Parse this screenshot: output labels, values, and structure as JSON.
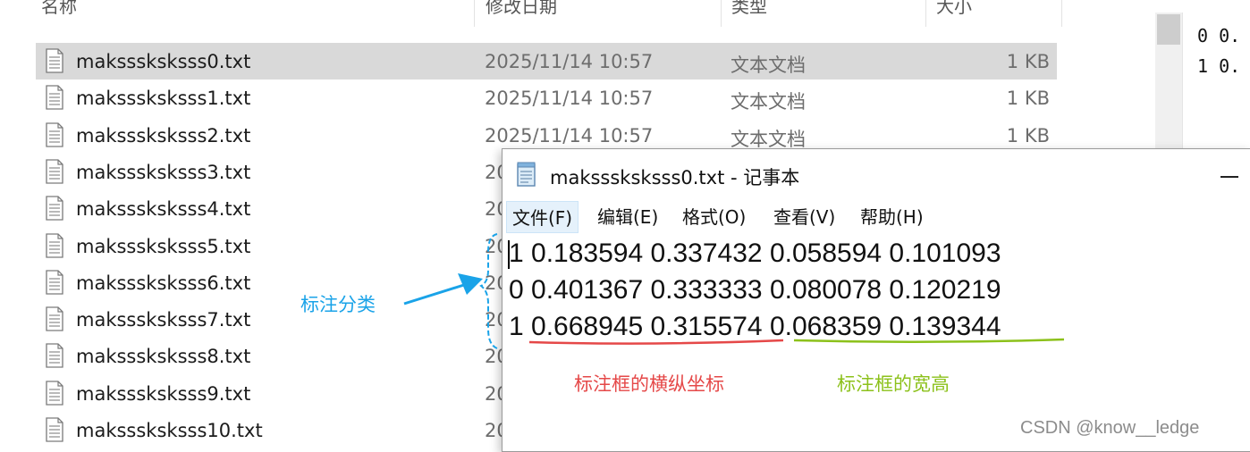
{
  "explorer": {
    "columns": [
      {
        "label": "名称"
      },
      {
        "label": "修改日期"
      },
      {
        "label": "类型"
      },
      {
        "label": "大小"
      }
    ],
    "files": [
      {
        "name": "maksssksksss0.txt",
        "date": "2025/11/14 10:57",
        "type": "文本文档",
        "size": "1 KB",
        "selected": true
      },
      {
        "name": "maksssksksss1.txt",
        "date": "2025/11/14 10:57",
        "type": "文本文档",
        "size": "1 KB"
      },
      {
        "name": "maksssksksss2.txt",
        "date": "2025/11/14 10:57",
        "type": "文本文档",
        "size": "1 KB"
      },
      {
        "name": "maksssksksss3.txt",
        "date": "20",
        "type": "",
        "size": ""
      },
      {
        "name": "maksssksksss4.txt",
        "date": "20",
        "type": "",
        "size": ""
      },
      {
        "name": "maksssksksss5.txt",
        "date": "20",
        "type": "",
        "size": ""
      },
      {
        "name": "maksssksksss6.txt",
        "date": "20",
        "type": "",
        "size": ""
      },
      {
        "name": "maksssksksss7.txt",
        "date": "20",
        "type": "",
        "size": ""
      },
      {
        "name": "maksssksksss8.txt",
        "date": "20",
        "type": "",
        "size": ""
      },
      {
        "name": "maksssksksss9.txt",
        "date": "20",
        "type": "",
        "size": ""
      },
      {
        "name": "maksssksksss10.txt",
        "date": "20",
        "type": "",
        "size": ""
      }
    ]
  },
  "preview": {
    "lines": [
      "0 0.",
      "1 0."
    ]
  },
  "notepad": {
    "title": "maksssksksss0.txt - 记事本",
    "menu": [
      "文件(F)",
      "编辑(E)",
      "格式(O)",
      "查看(V)",
      "帮助(H)"
    ],
    "lines": [
      "1 0.183594 0.337432 0.058594 0.101093",
      "0 0.401367 0.333333 0.080078 0.120219",
      "1 0.668945 0.315574 0.068359 0.139344"
    ]
  },
  "annotations": {
    "class_label": "标注分类",
    "xy_label": "标注框的横纵坐标",
    "wh_label": "标注框的宽高",
    "colors": {
      "class": "#1aa3e8",
      "xy": "#e54848",
      "wh": "#8cc11b"
    }
  },
  "watermark": "CSDN @know__ledge"
}
